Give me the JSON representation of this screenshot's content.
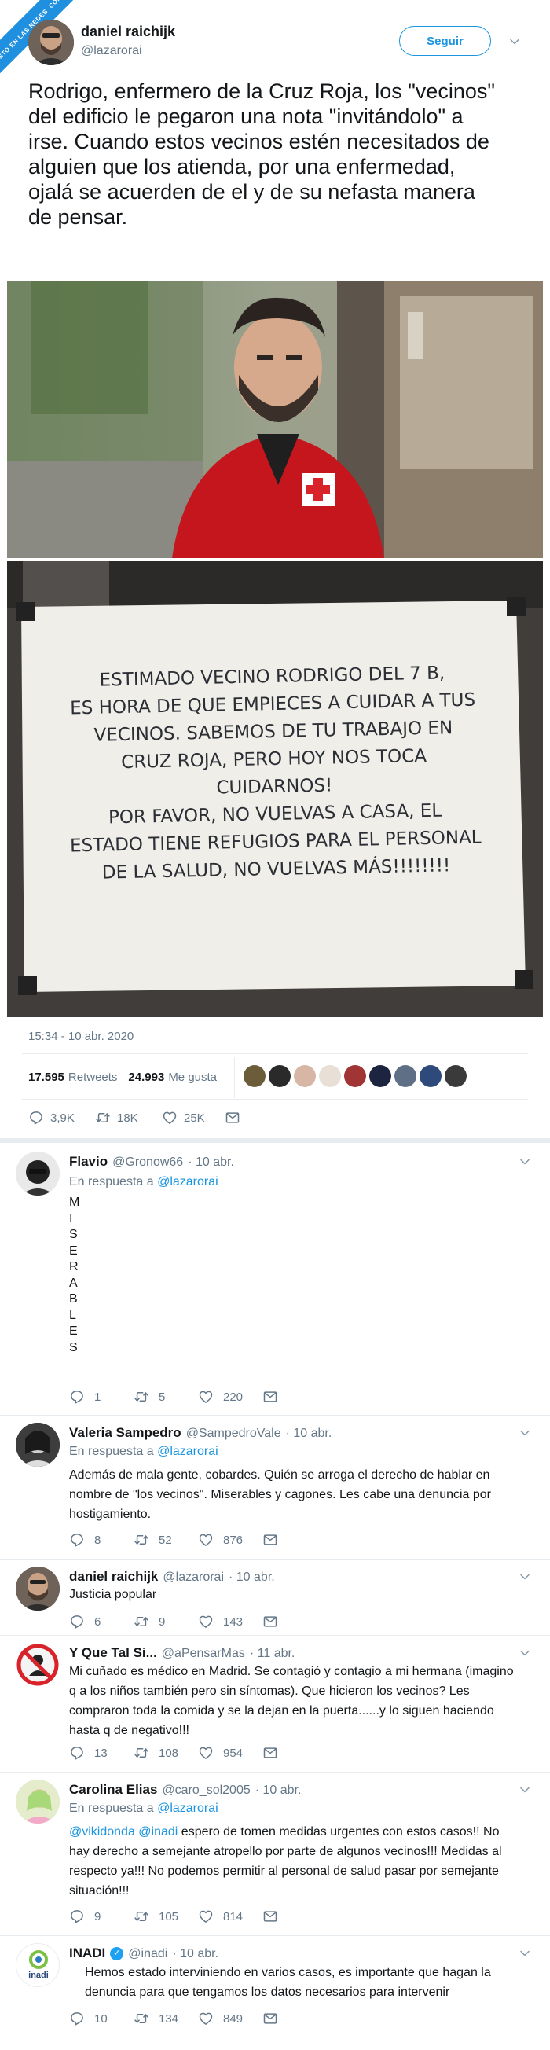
{
  "watermark": "VISTO EN LAS REDES .COM",
  "main": {
    "name": "daniel raichijk",
    "handle": "@lazarorai",
    "follow_label": "Seguir",
    "text": "Rodrigo, enfermero de la Cruz Roja, los \"vecinos\" del edificio le pegaron una nota \"invitándolo\" a irse. Cuando estos vecinos estén necesitados de alguien que los atienda, por una enfermedad, ojalá se acuerden de el y de su nefasta manera de pensar.",
    "note_lines": [
      "ESTIMADO VECINO RODRIGO DEL 7 B,",
      "ES HORA DE QUE EMPIECES A CUIDAR A TUS",
      "VECINOS. SABEMOS DE TU TRABAJO EN",
      "CRUZ ROJA, PERO HOY NOS TOCA",
      "CUIDARNOS!",
      "POR FAVOR, NO VUELVAS A CASA, EL",
      "ESTADO TIENE REFUGIOS PARA EL PERSONAL",
      "DE LA SALUD, NO VUELVAS MÁS!!!!!!!!"
    ],
    "timestamp": "15:34 - 10 abr. 2020",
    "retweets_count": "17.595",
    "retweets_label": "Retweets",
    "likes_count": "24.993",
    "likes_label": "Me gusta",
    "reply_count": "3,9K",
    "rt_count": "18K",
    "like_count": "25K"
  },
  "replies": [
    {
      "name": "Flavio",
      "handle": "@Gronow66",
      "date": "· 10 abr.",
      "in_reply_prefix": "En respuesta a",
      "in_reply_to": "@lazarorai",
      "letters": [
        "M",
        "I",
        "S",
        "E",
        "R",
        "A",
        "B",
        "L",
        "E",
        "S"
      ],
      "replies": "1",
      "rts": "5",
      "likes": "220"
    },
    {
      "name": "Valeria Sampedro",
      "handle": "@SampedroVale",
      "date": "· 10 abr.",
      "in_reply_prefix": "En respuesta a",
      "in_reply_to": "@lazarorai",
      "lines": [
        "Además de mala gente, cobardes. Quién se arroga el derecho de hablar en",
        "nombre de \"los vecinos\". Miserables y cagones. Les cabe una denuncia por",
        "hostigamiento."
      ],
      "replies": "8",
      "rts": "52",
      "likes": "876"
    },
    {
      "name": "daniel raichijk",
      "handle": "@lazarorai",
      "date": "· 10 abr.",
      "lines": [
        "Justicia popular"
      ],
      "replies": "6",
      "rts": "9",
      "likes": "143"
    },
    {
      "name": "Y Que Tal Si...",
      "handle": "@aPensarMas",
      "date": "· 11 abr.",
      "lines": [
        "Mi cuñado es médico en Madrid. Se contagió y contagio a mi hermana (imagino",
        "q a los niños también pero sin síntomas). Que hicieron los vecinos? Les",
        "compraron toda la comida y se la dejan en la puerta......y lo siguen haciendo",
        "hasta q de negativo!!!"
      ],
      "replies": "13",
      "rts": "108",
      "likes": "954"
    },
    {
      "name": "Carolina Elias",
      "handle": "@caro_sol2005",
      "date": "· 10 abr.",
      "in_reply_prefix": "En respuesta a",
      "in_reply_to": "@lazarorai",
      "mention1": "@vikidonda",
      "mention2": "@inadi",
      "lines": [
        " espero de tomen medidas urgentes con estos casos!! No",
        "hay derecho a semejante atropello por parte de algunos vecinos!!! Medidas al",
        "respecto ya!!! No podemos permitir al personal de salud pasar por semejante",
        "situación!!!"
      ],
      "replies": "9",
      "rts": "105",
      "likes": "814"
    },
    {
      "name": "INADI",
      "handle": "@inadi",
      "date": "· 10 abr.",
      "avatar_label": "inadi",
      "lines": [
        "Hemos estado interviniendo en varios casos, es importante que hagan la",
        "denuncia para que tengamos los datos necesarios para intervenir"
      ],
      "replies": "10",
      "rts": "134",
      "likes": "849"
    }
  ],
  "colors": {
    "accent": "#1b95e0",
    "muted": "#657786",
    "rt_green": "#17bf63",
    "cross_red": "#d8232a",
    "jacket": "#c4161c"
  }
}
